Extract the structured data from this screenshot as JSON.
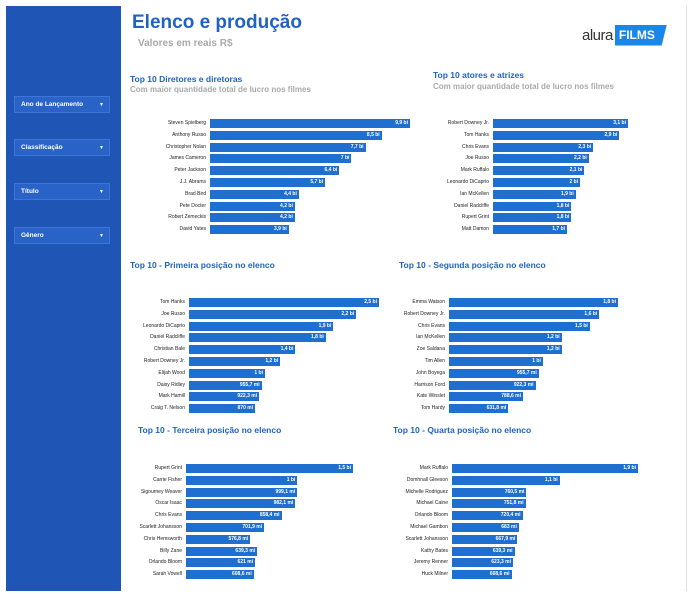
{
  "header": {
    "title": "Elenco e produção",
    "subtitle": "Valores em reais R$",
    "logo_word": "alura",
    "logo_box": "FILMS"
  },
  "filters": [
    {
      "label": "Ano de Lançamento"
    },
    {
      "label": "Classificação"
    },
    {
      "label": "Título"
    },
    {
      "label": "Gênero"
    }
  ],
  "chart_data": [
    {
      "type": "bar",
      "title": "Top 10 Diretores e diretoras",
      "subtitle": "Com maior quantidade total de lucro nos filmes",
      "categories": [
        "Steven Spielberg",
        "Anthony Russo",
        "Christopher Nolan",
        "James Cameron",
        "Peter Jackson",
        "J.J. Abrams",
        "Brad Bird",
        "Pete Docter",
        "Robert Zemeckis",
        "David Yates"
      ],
      "values": [
        9.9,
        8.5,
        7.7,
        7.0,
        6.4,
        5.7,
        4.4,
        4.2,
        4.2,
        3.9
      ],
      "labels": [
        "9,9 bi",
        "8,5 bi",
        "7,7 bi",
        "7 bi",
        "6,4 bi",
        "5,7 bi",
        "4,4 bi",
        "4,2 bi",
        "4,2 bi",
        "3,9 bi"
      ],
      "color": "#1f6fd0"
    },
    {
      "type": "bar",
      "title": "Top 10 atores e atrizes",
      "subtitle": "Com maior quantidade total de lucro nos filmes",
      "categories": [
        "Robert Downey Jr.",
        "Tom Hanks",
        "Chris Evans",
        "Joe Russo",
        "Mark Ruffalo",
        "Leonardo DiCaprio",
        "Ian McKellen",
        "Daniel Radcliffe",
        "Rupert Grint",
        "Matt Damon"
      ],
      "values": [
        3.1,
        2.9,
        2.3,
        2.2,
        2.1,
        2.0,
        1.9,
        1.8,
        1.8,
        1.7
      ],
      "labels": [
        "3,1 bi",
        "2,9 bi",
        "2,3 bi",
        "2,2 bi",
        "2,1 bi",
        "2 bi",
        "1,9 bi",
        "1,8 bi",
        "1,8 bi",
        "1,7 bi"
      ],
      "color": "#1f6fd0"
    },
    {
      "type": "bar",
      "title": "Top 10 - Primeira posição no elenco",
      "categories": [
        "Tom Hanks",
        "Joe Russo",
        "Leonardo DiCaprio",
        "Daniel Radcliffe",
        "Christian Bale",
        "Robert Downey Jr.",
        "Elijah Wood",
        "Daisy Ridley",
        "Mark Hamill",
        "Craig T. Nelson"
      ],
      "values": [
        2.5,
        2.2,
        1.9,
        1.8,
        1.4,
        1.2,
        1.0,
        0.9557,
        0.9223,
        0.87
      ],
      "labels": [
        "2,5 bi",
        "2,2 bi",
        "1,9 bi",
        "1,8 bi",
        "1,4 bi",
        "1,2 bi",
        "1 bi",
        "955,7 mi",
        "922,3 mi",
        "870 mi"
      ],
      "color": "#1f6fd0"
    },
    {
      "type": "bar",
      "title": "Top 10 - Segunda posição no elenco",
      "categories": [
        "Emma Watson",
        "Robert Downey Jr.",
        "Chris Evans",
        "Ian McKellen",
        "Zoe Saldana",
        "Tim Allen",
        "John Boyega",
        "Harrison Ford",
        "Kate Winslet",
        "Tom Hardy"
      ],
      "values": [
        1.8,
        1.6,
        1.5,
        1.2,
        1.2,
        1.0,
        0.9557,
        0.9223,
        0.7886,
        0.6318
      ],
      "labels": [
        "1,8 bi",
        "1,6 bi",
        "1,5 bi",
        "1,2 bi",
        "1,2 bi",
        "1 bi",
        "955,7 mi",
        "922,3 mi",
        "788,6 mi",
        "631,8 mi"
      ],
      "color": "#1f6fd0"
    },
    {
      "type": "bar",
      "title": "Top 10 - Terceira posição no elenco",
      "categories": [
        "Rupert Grint",
        "Carrie Fisher",
        "Sigourney Weaver",
        "Oscar Isaac",
        "Chris Evans",
        "Scarlett Johansson",
        "Chris Hemsworth",
        "Billy Zane",
        "Orlando Bloom",
        "Sarah Vowell"
      ],
      "values": [
        1.5,
        1.0,
        0.9991,
        0.9821,
        0.8584,
        0.7019,
        0.5768,
        0.6393,
        0.621,
        0.6086
      ],
      "labels": [
        "1,5 bi",
        "1 bi",
        "999,1 mi",
        "982,1 mi",
        "858,4 mi",
        "701,9 mi",
        "576,8 mi",
        "639,3 mi",
        "621 mi",
        "608,6 mi"
      ],
      "color": "#1f6fd0"
    },
    {
      "type": "bar",
      "title": "Top 10 - Quarta posição no elenco",
      "categories": [
        "Mark Ruffalo",
        "Domhnall Gleeson",
        "Michelle Rodriguez",
        "Michael Caine",
        "Orlando Bloom",
        "Michael Gambon",
        "Scarlett Johansson",
        "Kathy Bates",
        "Jeremy Renner",
        "Huck Milner"
      ],
      "values": [
        1.9,
        1.1,
        0.7605,
        0.7518,
        0.7204,
        0.683,
        0.6679,
        0.6393,
        0.6233,
        0.6086
      ],
      "labels": [
        "1,9 bi",
        "1,1 bi",
        "760,5 mi",
        "751,8 mi",
        "720,4 mi",
        "683 mi",
        "667,9 mi",
        "639,3 mi",
        "623,3 mi",
        "608,6 mi"
      ],
      "color": "#1f6fd0"
    }
  ]
}
